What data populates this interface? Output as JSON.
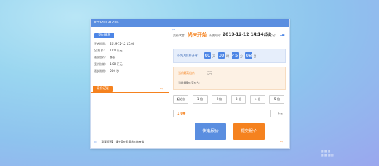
{
  "window": {
    "title": "bzxl20191206"
  },
  "left_panel": {
    "section1_title": "竞价概况",
    "fields": [
      {
        "label": "开始时间:",
        "value": "2019-12-12 15:00"
      },
      {
        "label": "起 报 价:",
        "value": "1.00 万元"
      },
      {
        "label": "最低加价:",
        "value": "加价"
      },
      {
        "label": "竞价阶梯:",
        "value": "1.00 万元"
      },
      {
        "label": "最长限期:",
        "value": "200 秒"
      }
    ],
    "section2_title": "竞价记录",
    "notice_text": "【重要提示】 请在竞价阶段出价的有效",
    "collapse_icon": "arrow-icon"
  },
  "right_panel": {
    "status_label": "竞价状态:",
    "status_value": "尚未开始",
    "time_label": "系统时间:",
    "time_value": "2019-12-12 14:14:52",
    "network_label": "网络状况:",
    "countdown": {
      "label": "距离竞价开始:",
      "days": "00",
      "days_unit": "天",
      "hours": "00",
      "hours_unit": "时",
      "minutes": "45",
      "minutes_unit": "分",
      "seconds": "08",
      "seconds_unit": "秒"
    },
    "price_box": {
      "current_label": "当前最高出价",
      "current_unit": "万元",
      "my_label": "当前最高价竞价人:"
    },
    "steps": [
      "起始价",
      "1 倍",
      "2 倍",
      "3 倍",
      "4 倍",
      "5 倍"
    ],
    "price_input_value": "1.00",
    "price_unit": "万元",
    "quick_button": "快速报价",
    "submit_button": "提交报价"
  },
  "colors": {
    "accent_blue": "#4d86e6",
    "accent_orange": "#f5821f"
  }
}
